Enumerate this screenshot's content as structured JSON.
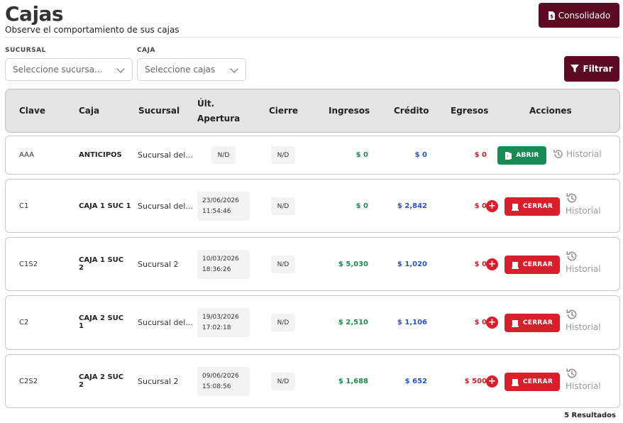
{
  "header": {
    "title": "Cajas",
    "subtitle": "Observe el comportamiento de sus cajas",
    "consolidado_label": "Consolidado"
  },
  "filters": {
    "sucursal_label": "SUCURSAL",
    "sucursal_placeholder": "Seleccione sucursa...",
    "caja_label": "CAJA",
    "caja_placeholder": "Seleccione cajas",
    "filtrar_label": "Filtrar"
  },
  "table": {
    "columns": {
      "clave": "Clave",
      "caja": "Caja",
      "sucursal": "Sucursal",
      "ult_apertura": "Últ. Apertura",
      "cierre": "Cierre",
      "ingresos": "Ingresos",
      "credito": "Crédito",
      "egresos": "Egresos",
      "acciones": "Acciones"
    },
    "rows": [
      {
        "clave": "AAA",
        "caja": "ANTICIPOS",
        "sucursal": "Sucursal del...",
        "apertura": "N/D",
        "apertura_fecha": "",
        "apertura_hora": "",
        "cierre": "N/D",
        "ingresos": "$ 0",
        "credito": "$ 0",
        "egresos": "$ 0",
        "accion": "ABRIR",
        "historial": "Historial"
      },
      {
        "clave": "C1",
        "caja": "CAJA 1 SUC 1",
        "sucursal": "Sucursal del...",
        "apertura_fecha": "23/06/2026",
        "apertura_hora": "11:54:46",
        "cierre": "N/D",
        "ingresos": "$ 0",
        "credito": "$ 2,842",
        "egresos": "$ 0",
        "accion": "CERRAR",
        "historial": "Historial"
      },
      {
        "clave": "C1S2",
        "caja": "CAJA 1 SUC 2",
        "sucursal": "Sucursal 2",
        "apertura_fecha": "10/03/2026",
        "apertura_hora": "18:36:26",
        "cierre": "N/D",
        "ingresos": "$ 5,030",
        "credito": "$ 1,020",
        "egresos": "$ 0",
        "accion": "CERRAR",
        "historial": "Historial"
      },
      {
        "clave": "C2",
        "caja": "CAJA 2 SUC 1",
        "sucursal": "Sucursal del...",
        "apertura_fecha": "19/03/2026",
        "apertura_hora": "17:02:18",
        "cierre": "N/D",
        "ingresos": "$ 2,510",
        "credito": "$ 1,106",
        "egresos": "$ 0",
        "accion": "CERRAR",
        "historial": "Historial"
      },
      {
        "clave": "C2S2",
        "caja": "CAJA 2 SUC 2",
        "sucursal": "Sucursal 2",
        "apertura_fecha": "09/06/2026",
        "apertura_hora": "15:08:56",
        "cierre": "N/D",
        "ingresos": "$ 1,688",
        "credito": "$ 652",
        "egresos": "$ 500",
        "accion": "CERRAR",
        "historial": "Historial"
      }
    ]
  },
  "footer": {
    "results": "5 Resultados"
  },
  "colors": {
    "brand": "#5c0a24",
    "ingresos": "#1e8a4c",
    "credito": "#2a54c4",
    "egresos": "#c0242e",
    "abrir": "#178a55",
    "cerrar": "#d8202c"
  },
  "icons": {
    "consolidado": "document-dollar-icon",
    "filtrar": "funnel-icon",
    "abrir": "door-open-icon",
    "cerrar": "lock-icon",
    "historial": "history-icon",
    "plus": "plus-circle-icon"
  }
}
